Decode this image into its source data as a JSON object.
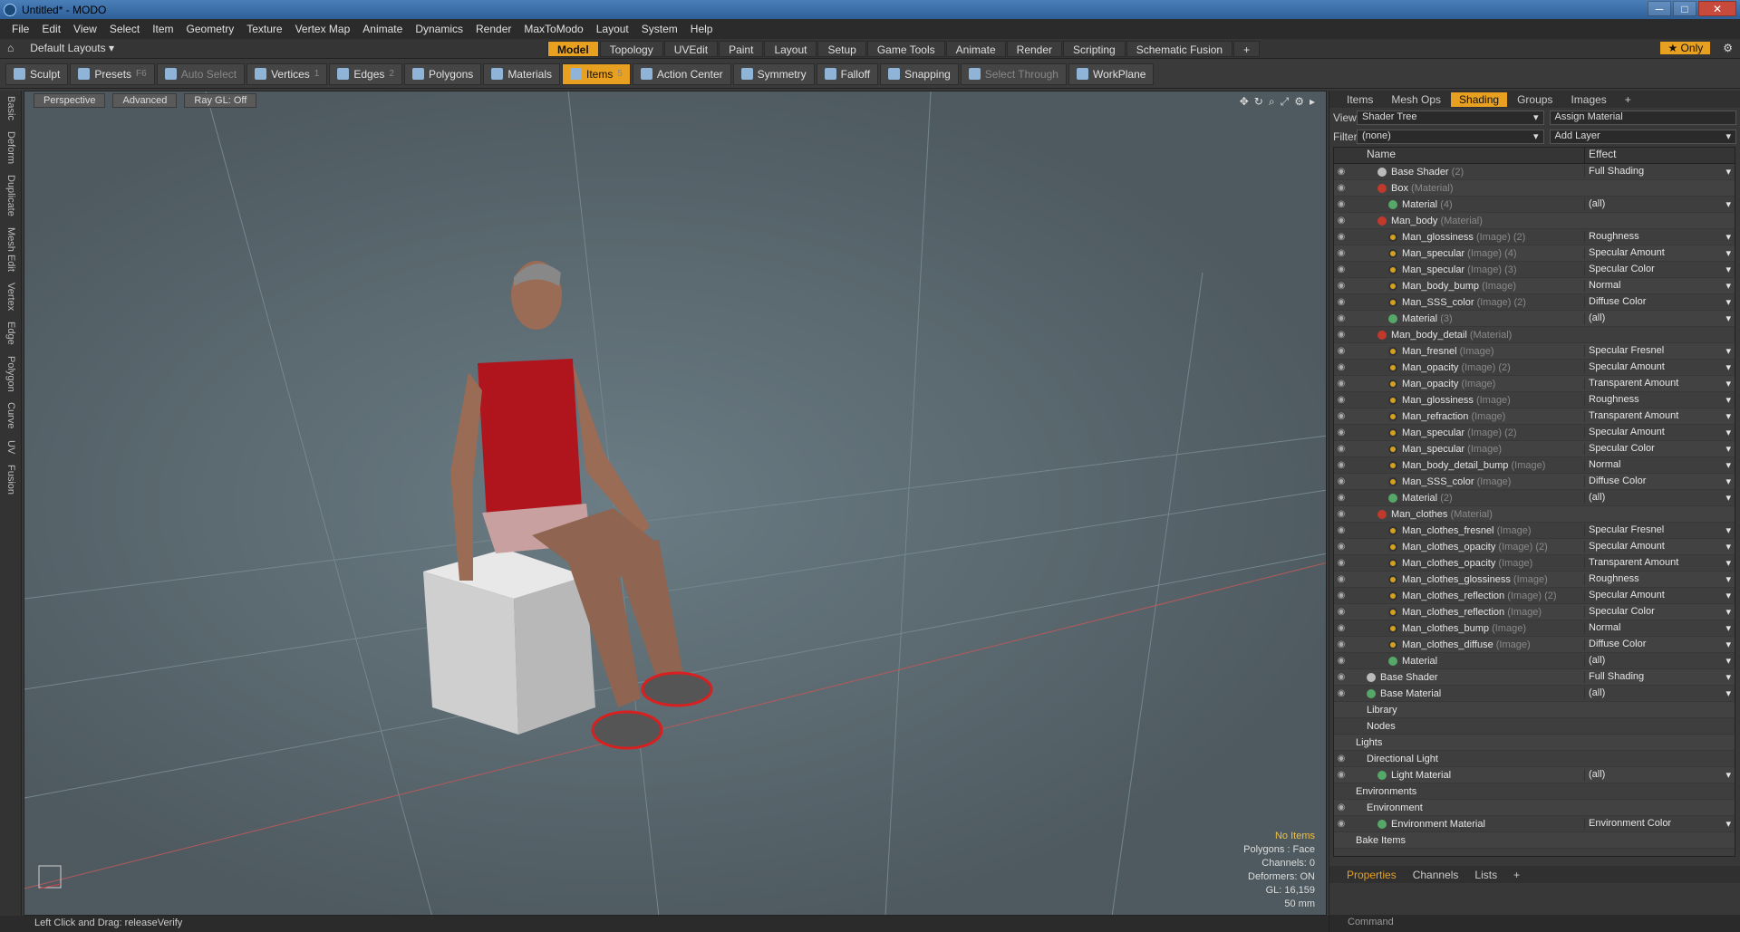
{
  "window": {
    "title": "Untitled* - MODO"
  },
  "menu": [
    "File",
    "Edit",
    "View",
    "Select",
    "Item",
    "Geometry",
    "Texture",
    "Vertex Map",
    "Animate",
    "Dynamics",
    "Render",
    "MaxToModo",
    "Layout",
    "System",
    "Help"
  ],
  "layoutbar": {
    "default_layouts": "Default Layouts ▾",
    "tabs": [
      "Model",
      "Topology",
      "UVEdit",
      "Paint",
      "Layout",
      "Setup",
      "Game Tools",
      "Animate",
      "Render",
      "Scripting",
      "Schematic Fusion",
      "+"
    ],
    "active_tab": "Model",
    "only_label": "★ Only"
  },
  "toolbar": [
    {
      "label": "Sculpt",
      "key": ""
    },
    {
      "label": "Presets",
      "key": "F6"
    },
    {
      "label": "Auto Select",
      "key": "",
      "disabled": true
    },
    {
      "label": "Vertices",
      "key": "1"
    },
    {
      "label": "Edges",
      "key": "2"
    },
    {
      "label": "Polygons",
      "key": ""
    },
    {
      "label": "Materials",
      "key": ""
    },
    {
      "label": "Items",
      "key": "5",
      "active": true
    },
    {
      "label": "Action Center",
      "key": ""
    },
    {
      "label": "Symmetry",
      "key": ""
    },
    {
      "label": "Falloff",
      "key": ""
    },
    {
      "label": "Snapping",
      "key": ""
    },
    {
      "label": "Select Through",
      "key": "",
      "disabled": true
    },
    {
      "label": "WorkPlane",
      "key": ""
    }
  ],
  "leftstrip": [
    "Basic",
    "Deform",
    "Duplicate",
    "Mesh Edit",
    "Vertex",
    "Edge",
    "Polygon",
    "Curve",
    "UV",
    "Fusion"
  ],
  "viewport": {
    "header": [
      "Perspective",
      "Advanced",
      "Ray GL: Off"
    ],
    "info": {
      "no_items": "No Items",
      "polygons": "Polygons : Face",
      "channels": "Channels: 0",
      "deformers": "Deformers: ON",
      "gl": "GL: 16,159",
      "focal": "50 mm"
    }
  },
  "status": "Left Click and Drag:   releaseVerify",
  "right_panel": {
    "tabs": [
      "Items",
      "Mesh Ops",
      "Shading",
      "Groups",
      "Images",
      "+"
    ],
    "active_tab": "Shading",
    "view_label": "View",
    "view_value": "Shader Tree",
    "assign": "Assign Material",
    "filter_label": "Filter",
    "filter_value": "(none)",
    "add_layer": "Add Layer",
    "columns": [
      "Name",
      "Effect"
    ],
    "rows": [
      {
        "indent": 2,
        "dot": "grey",
        "name": "Base Shader",
        "type": "(2)",
        "effect": "Full Shading",
        "eye": true
      },
      {
        "indent": 2,
        "dot": "red",
        "name": "Box",
        "type": "(Material)",
        "effect": "",
        "eye": true
      },
      {
        "indent": 3,
        "dot": "green",
        "name": "Material",
        "type": "(4)",
        "effect": "(all)",
        "eye": true
      },
      {
        "indent": 2,
        "dot": "red",
        "name": "Man_body",
        "type": "(Material)",
        "effect": "",
        "eye": true
      },
      {
        "indent": 3,
        "dot": "img",
        "name": "Man_glossiness",
        "type": "(Image) (2)",
        "effect": "Roughness",
        "eye": true
      },
      {
        "indent": 3,
        "dot": "img",
        "name": "Man_specular",
        "type": "(Image) (4)",
        "effect": "Specular Amount",
        "eye": true
      },
      {
        "indent": 3,
        "dot": "img",
        "name": "Man_specular",
        "type": "(Image) (3)",
        "effect": "Specular Color",
        "eye": true
      },
      {
        "indent": 3,
        "dot": "img",
        "name": "Man_body_bump",
        "type": "(Image)",
        "effect": "Normal",
        "eye": true
      },
      {
        "indent": 3,
        "dot": "img",
        "name": "Man_SSS_color",
        "type": "(Image) (2)",
        "effect": "Diffuse Color",
        "eye": true
      },
      {
        "indent": 3,
        "dot": "green",
        "name": "Material",
        "type": "(3)",
        "effect": "(all)",
        "eye": true
      },
      {
        "indent": 2,
        "dot": "red",
        "name": "Man_body_detail",
        "type": "(Material)",
        "effect": "",
        "eye": true
      },
      {
        "indent": 3,
        "dot": "img",
        "name": "Man_fresnel",
        "type": "(Image)",
        "effect": "Specular Fresnel",
        "eye": true
      },
      {
        "indent": 3,
        "dot": "img",
        "name": "Man_opacity",
        "type": "(Image) (2)",
        "effect": "Specular Amount",
        "eye": true
      },
      {
        "indent": 3,
        "dot": "img",
        "name": "Man_opacity",
        "type": "(Image)",
        "effect": "Transparent Amount",
        "eye": true
      },
      {
        "indent": 3,
        "dot": "img",
        "name": "Man_glossiness",
        "type": "(Image)",
        "effect": "Roughness",
        "eye": true
      },
      {
        "indent": 3,
        "dot": "img",
        "name": "Man_refraction",
        "type": "(Image)",
        "effect": "Transparent Amount",
        "eye": true
      },
      {
        "indent": 3,
        "dot": "img",
        "name": "Man_specular",
        "type": "(Image) (2)",
        "effect": "Specular Amount",
        "eye": true
      },
      {
        "indent": 3,
        "dot": "img",
        "name": "Man_specular",
        "type": "(Image)",
        "effect": "Specular Color",
        "eye": true
      },
      {
        "indent": 3,
        "dot": "img",
        "name": "Man_body_detail_bump",
        "type": "(Image)",
        "effect": "Normal",
        "eye": true
      },
      {
        "indent": 3,
        "dot": "img",
        "name": "Man_SSS_color",
        "type": "(Image)",
        "effect": "Diffuse Color",
        "eye": true
      },
      {
        "indent": 3,
        "dot": "green",
        "name": "Material",
        "type": "(2)",
        "effect": "(all)",
        "eye": true
      },
      {
        "indent": 2,
        "dot": "red",
        "name": "Man_clothes",
        "type": "(Material)",
        "effect": "",
        "eye": true
      },
      {
        "indent": 3,
        "dot": "img",
        "name": "Man_clothes_fresnel",
        "type": "(Image)",
        "effect": "Specular Fresnel",
        "eye": true
      },
      {
        "indent": 3,
        "dot": "img",
        "name": "Man_clothes_opacity",
        "type": "(Image) (2)",
        "effect": "Specular Amount",
        "eye": true
      },
      {
        "indent": 3,
        "dot": "img",
        "name": "Man_clothes_opacity",
        "type": "(Image)",
        "effect": "Transparent Amount",
        "eye": true
      },
      {
        "indent": 3,
        "dot": "img",
        "name": "Man_clothes_glossiness",
        "type": "(Image)",
        "effect": "Roughness",
        "eye": true
      },
      {
        "indent": 3,
        "dot": "img",
        "name": "Man_clothes_reflection",
        "type": "(Image) (2)",
        "effect": "Specular Amount",
        "eye": true
      },
      {
        "indent": 3,
        "dot": "img",
        "name": "Man_clothes_reflection",
        "type": "(Image)",
        "effect": "Specular Color",
        "eye": true
      },
      {
        "indent": 3,
        "dot": "img",
        "name": "Man_clothes_bump",
        "type": "(Image)",
        "effect": "Normal",
        "eye": true
      },
      {
        "indent": 3,
        "dot": "img",
        "name": "Man_clothes_diffuse",
        "type": "(Image)",
        "effect": "Diffuse Color",
        "eye": true
      },
      {
        "indent": 3,
        "dot": "green",
        "name": "Material",
        "type": "",
        "effect": "(all)",
        "eye": true
      },
      {
        "indent": 1,
        "dot": "grey",
        "name": "Base Shader",
        "type": "",
        "effect": "Full Shading",
        "eye": true
      },
      {
        "indent": 1,
        "dot": "green",
        "name": "Base Material",
        "type": "",
        "effect": "(all)",
        "eye": true
      },
      {
        "indent": 1,
        "dot": "",
        "name": "Library",
        "type": "",
        "effect": "",
        "eye": false
      },
      {
        "indent": 1,
        "dot": "",
        "name": "Nodes",
        "type": "",
        "effect": "",
        "eye": false
      },
      {
        "indent": 0,
        "dot": "",
        "name": "Lights",
        "type": "",
        "effect": "",
        "eye": false
      },
      {
        "indent": 1,
        "dot": "",
        "name": "Directional Light",
        "type": "",
        "effect": "",
        "eye": true
      },
      {
        "indent": 2,
        "dot": "green",
        "name": "Light Material",
        "type": "",
        "effect": "(all)",
        "eye": true
      },
      {
        "indent": 0,
        "dot": "",
        "name": "Environments",
        "type": "",
        "effect": "",
        "eye": false
      },
      {
        "indent": 1,
        "dot": "",
        "name": "Environment",
        "type": "",
        "effect": "",
        "eye": true
      },
      {
        "indent": 2,
        "dot": "green",
        "name": "Environment Material",
        "type": "",
        "effect": "Environment Color",
        "eye": true
      },
      {
        "indent": 0,
        "dot": "",
        "name": "Bake Items",
        "type": "",
        "effect": "",
        "eye": false
      }
    ],
    "bottom_tabs": [
      "Properties",
      "Channels",
      "Lists",
      "+"
    ],
    "command_placeholder": "Command"
  }
}
